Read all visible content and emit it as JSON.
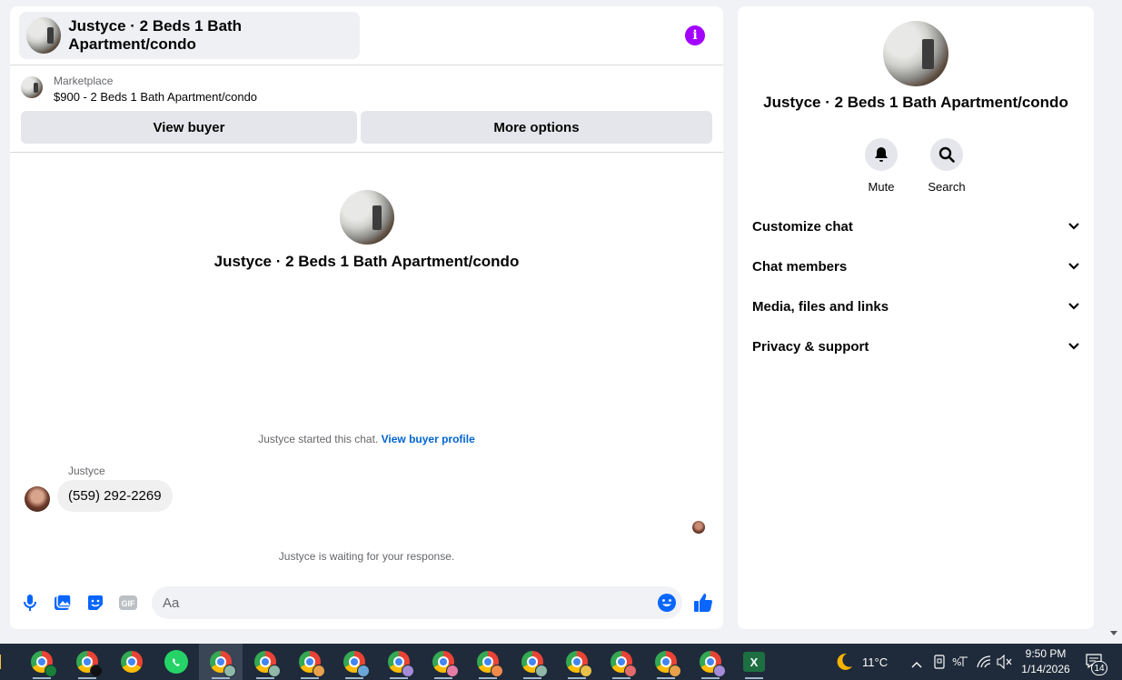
{
  "header": {
    "title": "Justyce · 2 Beds 1 Bath Apartment/condo"
  },
  "marketplace": {
    "label": "Marketplace",
    "listing": "$900 - 2 Beds 1 Bath Apartment/condo",
    "view_buyer_label": "View buyer",
    "more_options_label": "More options"
  },
  "intro": {
    "title": "Justyce · 2 Beds 1 Bath Apartment/condo"
  },
  "conversation": {
    "started_text": "Justyce started this chat.",
    "view_profile_link": "View buyer profile",
    "messages": [
      {
        "sender": "Justyce",
        "text": "(559) 292-2269"
      }
    ],
    "waiting_text": "Justyce is waiting for your response."
  },
  "composer": {
    "placeholder": "Aa",
    "icons": [
      "microphone-icon",
      "photo-icon",
      "sticker-icon",
      "gif-icon",
      "emoji-icon",
      "thumbs-up-icon"
    ],
    "gif_label": "GIF",
    "accent_color": "#0866ff"
  },
  "info_panel": {
    "title": "Justyce · 2 Beds 1 Bath Apartment/condo",
    "actions": [
      {
        "label": "Mute",
        "icon": "bell-icon"
      },
      {
        "label": "Search",
        "icon": "search-icon"
      }
    ],
    "sections": [
      {
        "label": "Customize chat"
      },
      {
        "label": "Chat members"
      },
      {
        "label": "Media, files and links"
      },
      {
        "label": "Privacy & support"
      }
    ]
  },
  "taskbar": {
    "weather": "11°C",
    "time": "9:50 PM",
    "date": "1/14/2026",
    "notification_count": "14",
    "excel_label": "X",
    "colors": {
      "background": "#1f2b3a"
    }
  }
}
